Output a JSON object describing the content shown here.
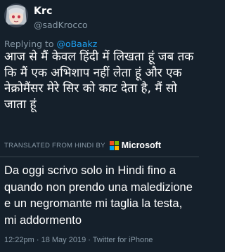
{
  "tweet": {
    "display_name": "Krc",
    "handle": "@sadKrocco",
    "reply_prefix": "Replying to ",
    "reply_to": "@oBaakz",
    "original_text": "आज से मैं केवल हिंदी में लिखता हूं जब तक कि मैं एक अभिशाप नहीं लेता हूं और एक नेक्रोमैंसर मेरे सिर को काट देता है, मैं सो जाता हूं",
    "translated_label": "TRANSLATED FROM HINDI BY",
    "translator_name": "Microsoft",
    "translation_text": "Da oggi scrivo solo in Hindi fino a quando non prendo una maledizione e un negromante mi taglia la testa, mi addormento",
    "meta": "12:22pm · 18 May 2019 · Twitter for iPhone"
  },
  "icons": {
    "avatar": "avatar-image",
    "microsoft_logo": "microsoft-logo-icon"
  },
  "colors": {
    "background": "#15202b",
    "text_primary": "#ffffff",
    "text_secondary": "#8899a6",
    "link": "#1da1f2",
    "divider": "#38444d"
  }
}
